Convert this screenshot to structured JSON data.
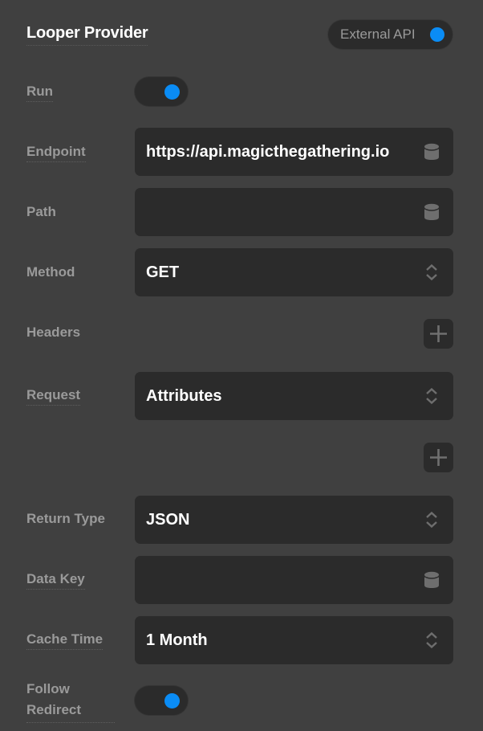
{
  "header": {
    "title": "Looper Provider",
    "mode_pill": {
      "label": "External API",
      "active": true,
      "dot_color": "#0a8cf5"
    }
  },
  "fields": {
    "run": {
      "label": "Run",
      "toggle_on": true
    },
    "endpoint": {
      "label": "Endpoint",
      "value": "https://api.magicthegathering.io",
      "icon": "database-icon"
    },
    "path": {
      "label": "Path",
      "value": "",
      "icon": "database-icon"
    },
    "method": {
      "label": "Method",
      "value": "GET",
      "icon": "chevron-up-down-icon"
    },
    "headers": {
      "label": "Headers",
      "add_icon": "plus-icon"
    },
    "request": {
      "label": "Request",
      "value": "Attributes",
      "icon": "chevron-up-down-icon",
      "add_icon": "plus-icon"
    },
    "return_type": {
      "label": "Return Type",
      "value": "JSON",
      "icon": "chevron-up-down-icon"
    },
    "data_key": {
      "label": "Data Key",
      "value": "",
      "icon": "database-icon"
    },
    "cache_time": {
      "label": "Cache Time",
      "value": "1 Month",
      "icon": "chevron-up-down-icon"
    },
    "follow_redirect": {
      "label_line1": "Follow",
      "label_line2": "Redirect",
      "toggle_on": true
    }
  },
  "colors": {
    "background": "#404040",
    "field_bg": "#2b2b2b",
    "accent": "#0a8cf5",
    "label": "#9a9a9a",
    "value": "#ffffff",
    "icon": "#6e6e6e"
  }
}
